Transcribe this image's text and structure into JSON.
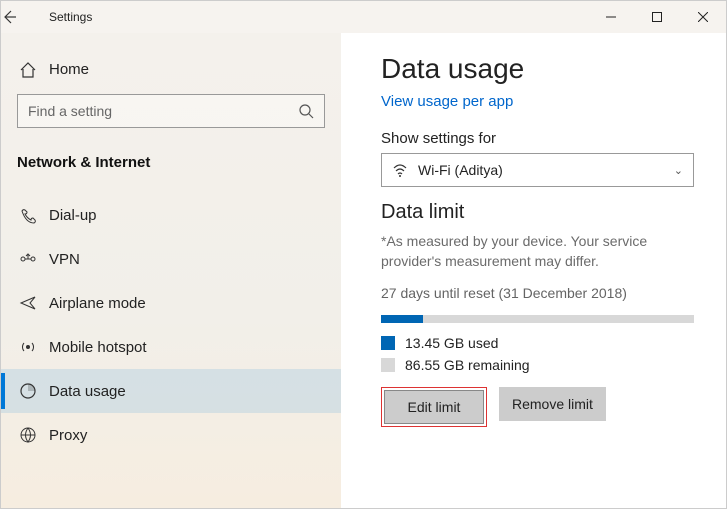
{
  "window": {
    "title": "Settings"
  },
  "sidebar": {
    "home": "Home",
    "search_placeholder": "Find a setting",
    "section": "Network & Internet",
    "items": [
      {
        "label": "Dial-up",
        "icon": "dialup-icon"
      },
      {
        "label": "VPN",
        "icon": "vpn-icon"
      },
      {
        "label": "Airplane mode",
        "icon": "airplane-icon"
      },
      {
        "label": "Mobile hotspot",
        "icon": "hotspot-icon"
      },
      {
        "label": "Data usage",
        "icon": "datausage-icon"
      },
      {
        "label": "Proxy",
        "icon": "proxy-icon"
      }
    ]
  },
  "main": {
    "title": "Data usage",
    "link": "View usage per app",
    "show_settings_label": "Show settings for",
    "dropdown_value": "Wi-Fi (Aditya)",
    "limit_heading": "Data limit",
    "note": "*As measured by your device. Your service provider's measurement may differ.",
    "reset_text": "27 days until reset (31 December 2018)",
    "used_text": "13.45 GB used",
    "remaining_text": "86.55 GB remaining",
    "progress_percent": 13.45,
    "colors": {
      "used": "#0066b4",
      "remaining": "#d8d8d8"
    },
    "buttons": {
      "edit": "Edit limit",
      "remove": "Remove limit"
    }
  }
}
